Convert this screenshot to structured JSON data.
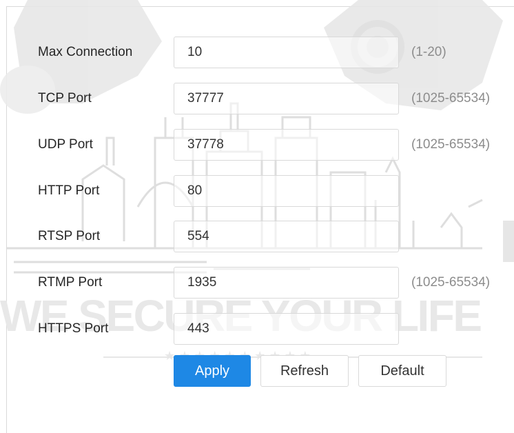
{
  "form": {
    "rows": [
      {
        "label": "Max Connection",
        "value": "10",
        "hint": "(1-20)"
      },
      {
        "label": "TCP Port",
        "value": "37777",
        "hint": "(1025-65534)"
      },
      {
        "label": "UDP Port",
        "value": "37778",
        "hint": "(1025-65534)"
      },
      {
        "label": "HTTP Port",
        "value": "80",
        "hint": ""
      },
      {
        "label": "RTSP Port",
        "value": "554",
        "hint": ""
      },
      {
        "label": "RTMP Port",
        "value": "1935",
        "hint": "(1025-65534)"
      },
      {
        "label": "HTTPS Port",
        "value": "443",
        "hint": ""
      }
    ]
  },
  "buttons": {
    "apply": "Apply",
    "refresh": "Refresh",
    "default": "Default"
  },
  "watermark": {
    "slogan": "WE SECURE YOUR LIFE"
  },
  "colors": {
    "primary": "#1e88e5",
    "label_text": "#262626",
    "hint_text": "#8c8c8c",
    "border": "#d9d9d9"
  }
}
